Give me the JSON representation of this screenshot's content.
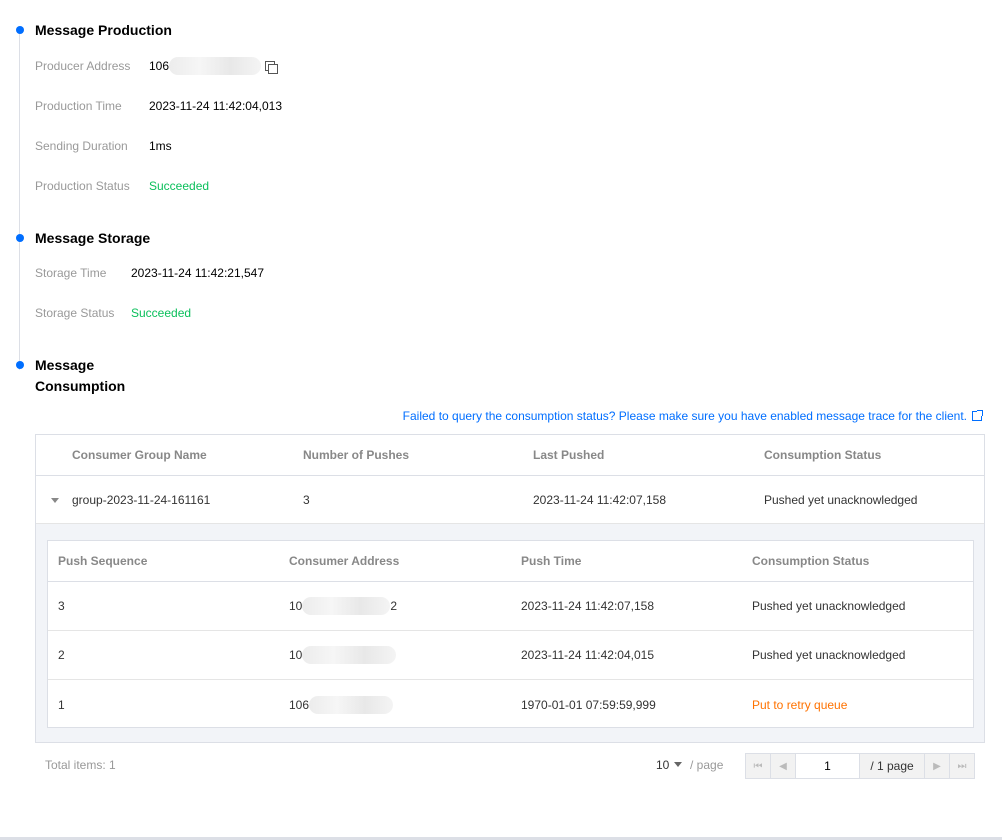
{
  "production": {
    "title": "Message Production",
    "producer_address_label": "Producer Address",
    "producer_address_prefix": "106",
    "production_time_label": "Production Time",
    "production_time": "2023-11-24 11:42:04,013",
    "sending_duration_label": "Sending Duration",
    "sending_duration": "1ms",
    "production_status_label": "Production Status",
    "production_status": "Succeeded"
  },
  "storage": {
    "title": "Message Storage",
    "storage_time_label": "Storage Time",
    "storage_time": "2023-11-24 11:42:21,547",
    "storage_status_label": "Storage Status",
    "storage_status": "Succeeded"
  },
  "consumption": {
    "title_line1": "Message",
    "title_line2": "Consumption",
    "tip_link": "Failed to query the consumption status? Please make sure you have enabled message trace for the client.",
    "outer_headers": [
      "Consumer Group Name",
      "Number of Pushes",
      "Last Pushed",
      "Consumption Status"
    ],
    "group_row": {
      "name": "group-2023-11-24-161161",
      "pushes": "3",
      "last_pushed": "2023-11-24 11:42:07,158",
      "status": "Pushed yet unacknowledged"
    },
    "inner_headers": [
      "Push Sequence",
      "Consumer Address",
      "Push Time",
      "Consumption Status"
    ],
    "inner_rows": [
      {
        "seq": "3",
        "addr_prefix": "10",
        "addr_suffix": "2",
        "time": "2023-11-24 11:42:07,158",
        "status": "Pushed yet unacknowledged"
      },
      {
        "seq": "2",
        "addr_prefix": "10",
        "addr_suffix": "",
        "time": "2023-11-24 11:42:04,015",
        "status": "Pushed yet unacknowledged"
      },
      {
        "seq": "1",
        "addr_prefix": "106",
        "addr_suffix": "",
        "time": "1970-01-01 07:59:59,999",
        "status": "Put to retry queue"
      }
    ]
  },
  "pagination": {
    "total": "Total items:  1",
    "page_size": "10",
    "per_page": "/ page",
    "current_page": "1",
    "total_pages": "/ 1 page"
  },
  "colors": {
    "accent": "#006eff",
    "success": "#0abf5b",
    "warning": "#ff7200"
  }
}
